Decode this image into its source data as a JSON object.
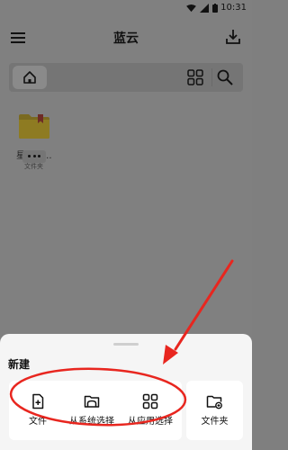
{
  "status_bar": {
    "time": "10:31"
  },
  "app_bar": {
    "title": "蓝云"
  },
  "files": [
    {
      "name": "星标文...",
      "type": "文件夹"
    }
  ],
  "sheet": {
    "title": "新建",
    "options": [
      {
        "label": "文件",
        "icon": "file-add-icon"
      },
      {
        "label": "从系统选择",
        "icon": "folder-browse-icon"
      },
      {
        "label": "从应用选择",
        "icon": "apps-grid-icon"
      },
      {
        "label": "文件夹",
        "icon": "folder-add-icon"
      }
    ]
  },
  "colors": {
    "annotation": "#e8261f",
    "folder": "#f2b705",
    "folder_tab": "#d93025"
  }
}
